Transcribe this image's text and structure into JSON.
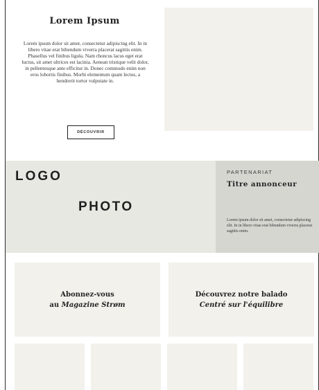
{
  "hero": {
    "title": "Lorem Ipsum",
    "body": "Lorem ipsum dolor sit amet, consectetur adipiscing elit. In in libero vitae erat bibendum viverra placerat sagittis enim. Phasellus vel finibus ligula. Nam rhoncus lacus eget erat luctus, sit amet ultrices est lacinia. Aenean tristique velit dolor, in pellentesque ante efficitur in. Donec commodo enim non eros lobortis finibus. Morbi elementum quam lectus, a hendrerit tortor vulputate in.",
    "button_label": "DÉCOUVRIR"
  },
  "band": {
    "logo_text": "LOGO",
    "photo_text": "PHOTO"
  },
  "partner": {
    "label": "PARTENARIAT",
    "title": "Titre annonceur",
    "body": "Lorem ipsum dolor sit amet, consectetur adipiscing elit. In in libero vitae erat bibendum viverra placerat sagittis enim."
  },
  "cards": {
    "magazine": {
      "line1": "Abonnez-vous",
      "line2_prefix": "au ",
      "line2_emph": "Magazine Strøm"
    },
    "podcast": {
      "line1": "Découvrez notre balado",
      "line2_emph": "Centré sur l'équilibre"
    }
  },
  "colors": {
    "panel_light": "#f2f1ec",
    "band_gray": "#e8e8e3",
    "partner_gray": "#d6d6d1",
    "text_dark": "#1f1f1f"
  }
}
